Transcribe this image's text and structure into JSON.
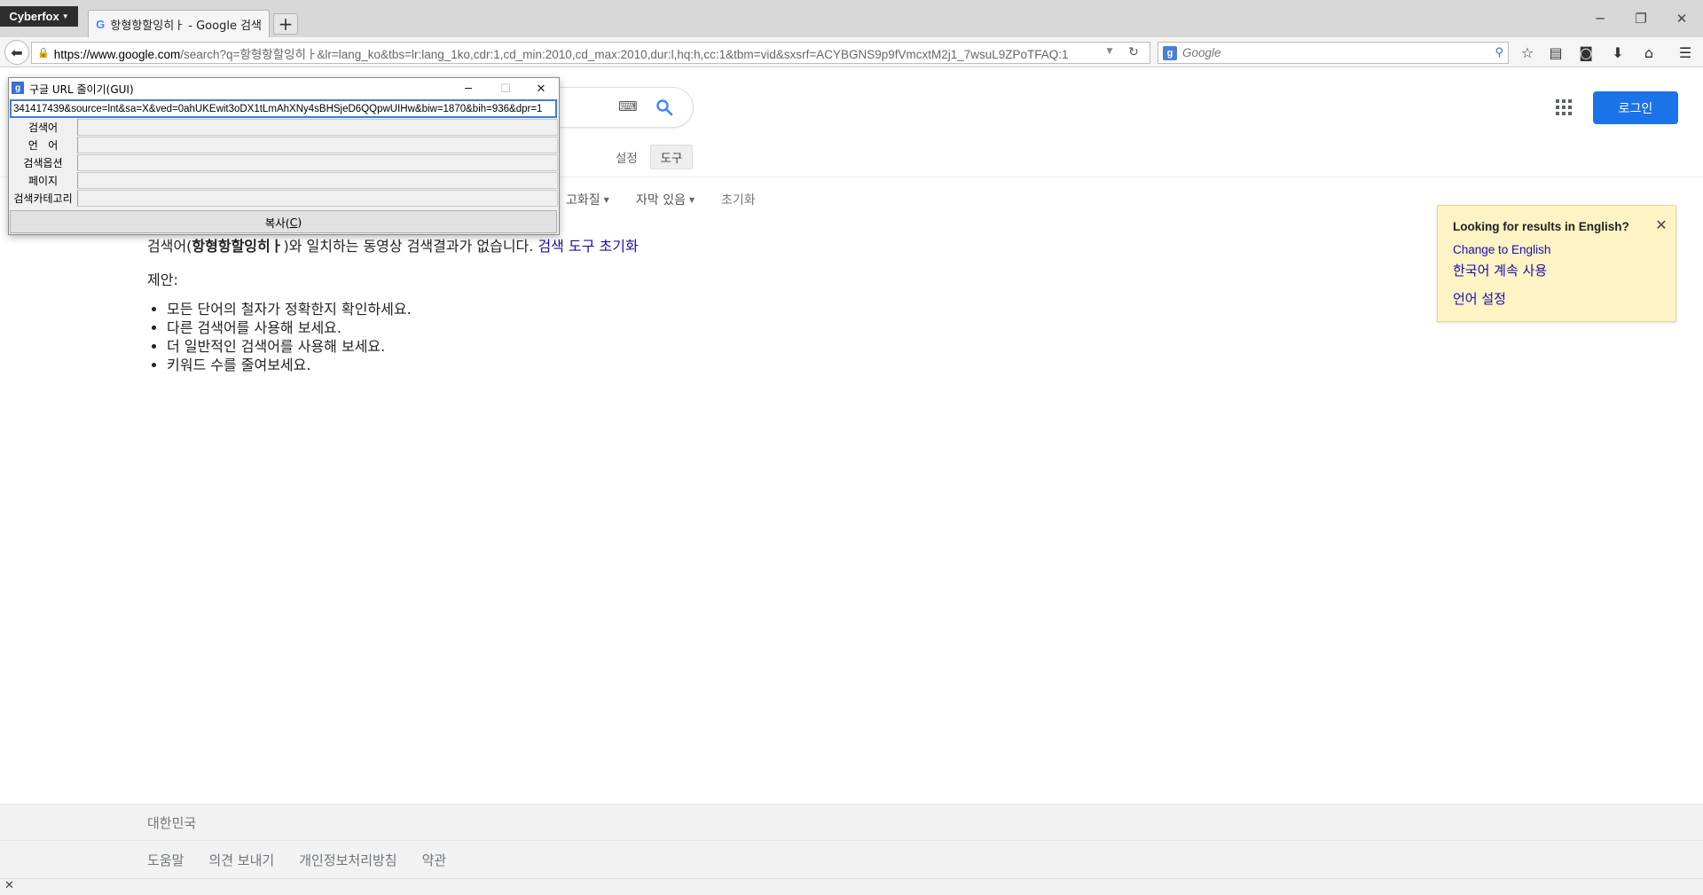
{
  "browser": {
    "app_menu_label": "Cyberfox",
    "tab_title": "항형항할잉히ㅏ - Google 검색",
    "new_tab_label": "+",
    "url_host": "https://www.google.com",
    "url_rest": "/search?q=항형항할잉히ㅏ&lr=lang_ko&tbs=lr:lang_1ko,cdr:1,cd_min:2010,cd_max:2010,dur:l,hq:h,cc:1&tbm=vid&sxsrf=ACYBGNS9p9fVmcxtM2j1_7wsuL9ZPoTFAQ:1",
    "search_placeholder": "Google"
  },
  "gui_window": {
    "title": "구글 URL 줄이기(GUI)",
    "url_value": "341417439&source=lnt&sa=X&ved=0ahUKEwit3oDX1tLmAhXNy4sBHSjeD6QQpwUIHw&biw=1870&bih=936&dpr=1",
    "rows": [
      {
        "label": "검색어",
        "value": ""
      },
      {
        "label": "언   어",
        "value": ""
      },
      {
        "label": "검색옵션",
        "value": ""
      },
      {
        "label": "페이지",
        "value": ""
      },
      {
        "label": "검색카테고리",
        "value": ""
      }
    ],
    "copy_label_prefix": "복사(",
    "copy_label_key": "C",
    "copy_label_suffix": ")"
  },
  "google": {
    "login_label": "로그인",
    "settings_label": "설정",
    "tools_label": "도구",
    "filters": {
      "quality": "고화질",
      "subtitles": "자막 있음",
      "reset": "초기화"
    },
    "no_results": {
      "prefix": "검색어(",
      "query": "항형항할잉히ㅏ",
      "suffix": ")와 일치하는 동영상 검색결과가 없습니다. ",
      "reset_link": "검색 도구 초기화"
    },
    "suggest_label": "제안:",
    "suggestions": [
      "모든 단어의 철자가 정확한지 확인하세요.",
      "다른 검색어를 사용해 보세요.",
      "더 일반적인 검색어를 사용해 보세요.",
      "키워드 수를 줄여보세요."
    ],
    "lang_popup": {
      "title": "Looking for results in English?",
      "change_english": "Change to English",
      "keep_korean": "한국어 계속 사용",
      "language_settings": "언어 설정"
    },
    "footer": {
      "country": "대한민국",
      "links": [
        "도움말",
        "의견 보내기",
        "개인정보처리방침",
        "약관"
      ]
    }
  },
  "colors": {
    "accent_blue": "#1a73e8",
    "link": "#1a0dab",
    "popup_bg": "#fdf3c4"
  }
}
